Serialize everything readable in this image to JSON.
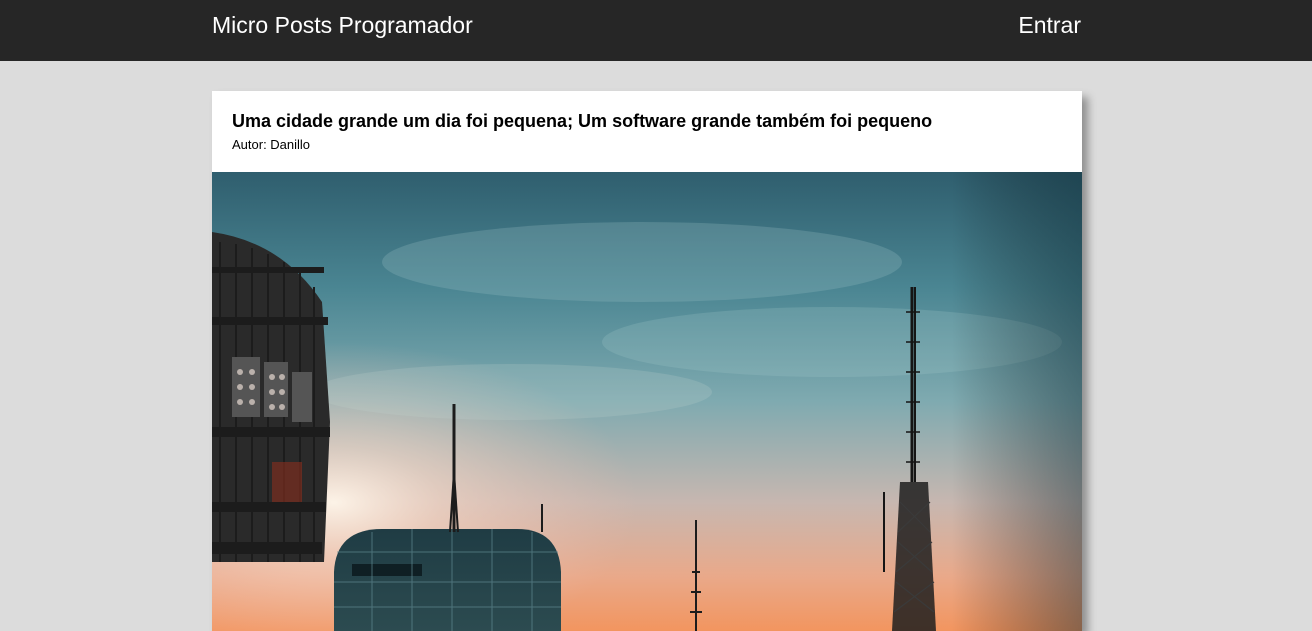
{
  "navbar": {
    "brand": "Micro Posts Programador",
    "login_label": "Entrar"
  },
  "post": {
    "title": "Uma cidade grande um dia foi pequena; Um software grande também foi pequeno",
    "author": "Autor: Danillo"
  }
}
